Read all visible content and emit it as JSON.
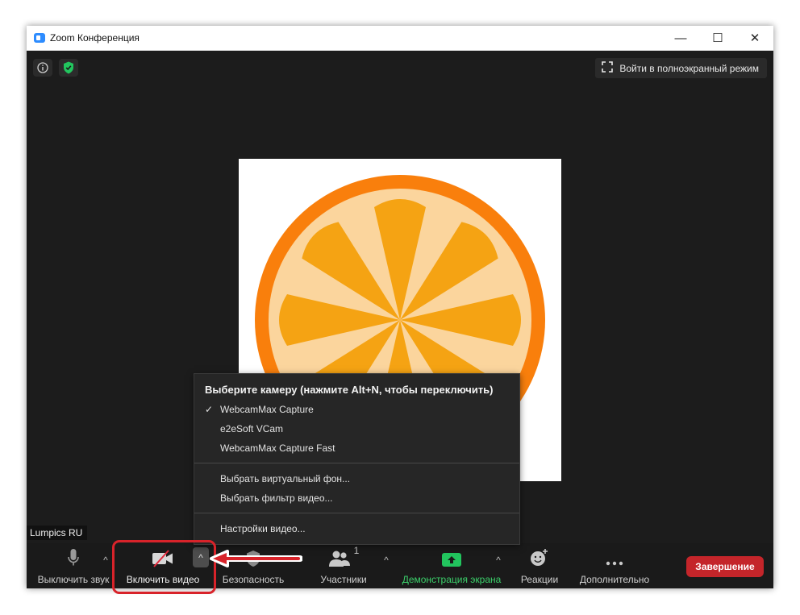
{
  "window": {
    "title": "Zoom Конференция",
    "minimize_glyph": "—",
    "maximize_glyph": "☐",
    "close_glyph": "✕"
  },
  "meeting": {
    "fullscreen_label": "Войти в полноэкранный режим",
    "participant_name": "Lumpics RU",
    "participant_count": "1"
  },
  "toolbar": {
    "mute_label": "Выключить звук",
    "video_label": "Включить видео",
    "security_label": "Безопасность",
    "participants_label": "Участники",
    "share_label": "Демонстрация экрана",
    "reactions_label": "Реакции",
    "more_label": "Дополнительно",
    "end_label": "Завершение",
    "caret_glyph": "^"
  },
  "camera_menu": {
    "header": "Выберите камеру (нажмите Alt+N, чтобы переключить)",
    "cameras": [
      "WebcamMax Capture",
      "e2eSoft VCam",
      "WebcamMax Capture Fast"
    ],
    "selected_check": "✓",
    "virtual_bg": "Выбрать виртуальный фон...",
    "video_filter": "Выбрать фильтр видео...",
    "settings": "Настройки видео..."
  },
  "colors": {
    "accent_green": "#3bcf6a",
    "end_red": "#c4252a",
    "highlight_red": "#d8232a",
    "orange_peel": "#f97f0c",
    "orange_pulp": "#f5a313"
  },
  "icons": {
    "info": "info-icon",
    "security_shield": "shield-icon",
    "fullscreen": "fullscreen-icon",
    "microphone": "microphone-icon",
    "video_off": "video-off-icon",
    "participants": "participants-icon",
    "share": "share-screen-icon",
    "reactions": "reactions-icon",
    "more": "more-icon"
  }
}
